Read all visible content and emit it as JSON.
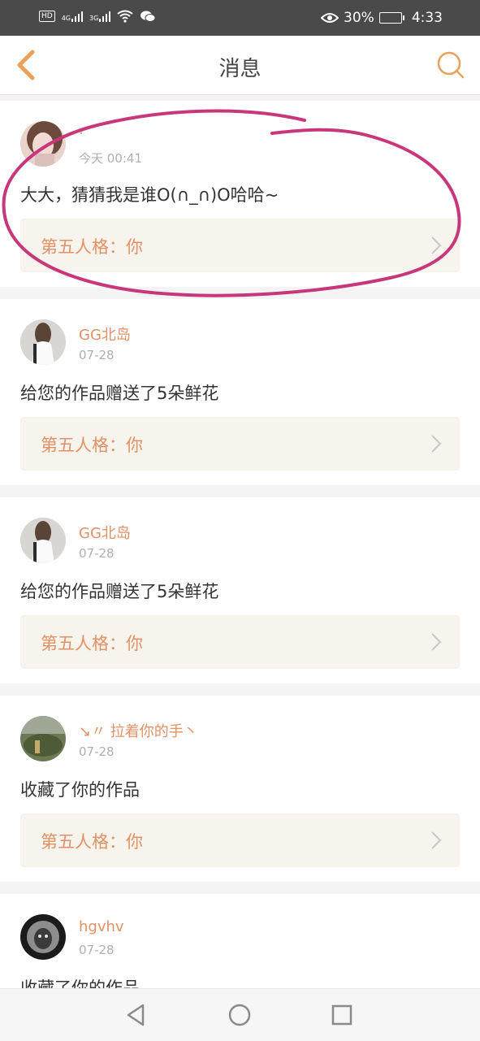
{
  "status_bar": {
    "hd": "HD",
    "net1": "4G",
    "net2": "3G",
    "battery": "30%",
    "time": "4:33",
    "icons": [
      "hd-icon",
      "signal-icon",
      "signal-icon",
      "wifi-icon",
      "wechat-icon",
      "eye-icon",
      "battery-icon"
    ]
  },
  "header": {
    "title": "消息",
    "back_icon": "chevron-left-icon",
    "search_icon": "search-icon",
    "accent": "#e8a25b"
  },
  "messages": [
    {
      "user": "·",
      "time": "今天 00:41",
      "text": "大大，猜猜我是谁O(∩_∩)O哈哈~",
      "work": "第五人格：你",
      "avatar": "avatar-girl-pink"
    },
    {
      "user": "GG北岛",
      "time": "07-28",
      "text": "给您的作品赠送了5朵鲜花",
      "work": "第五人格：你",
      "avatar": "avatar-girl-white"
    },
    {
      "user": "GG北岛",
      "time": "07-28",
      "text": "给您的作品赠送了5朵鲜花",
      "work": "第五人格：你",
      "avatar": "avatar-girl-white"
    },
    {
      "user": "↘〃 拉着你的手丶",
      "time": "07-28",
      "text": "收藏了你的作品",
      "work": "第五人格：你",
      "avatar": "avatar-landscape"
    },
    {
      "user": "hgvhv",
      "time": "07-28",
      "text": "收藏了你的作品",
      "work": "",
      "avatar": "avatar-lion"
    }
  ],
  "colors": {
    "username": "#e29166",
    "work_bg": "#f6f4ec",
    "annotation": "#c8377a"
  },
  "nav_bar": {
    "icons": [
      "back-triangle-icon",
      "home-circle-icon",
      "recent-square-icon"
    ]
  }
}
